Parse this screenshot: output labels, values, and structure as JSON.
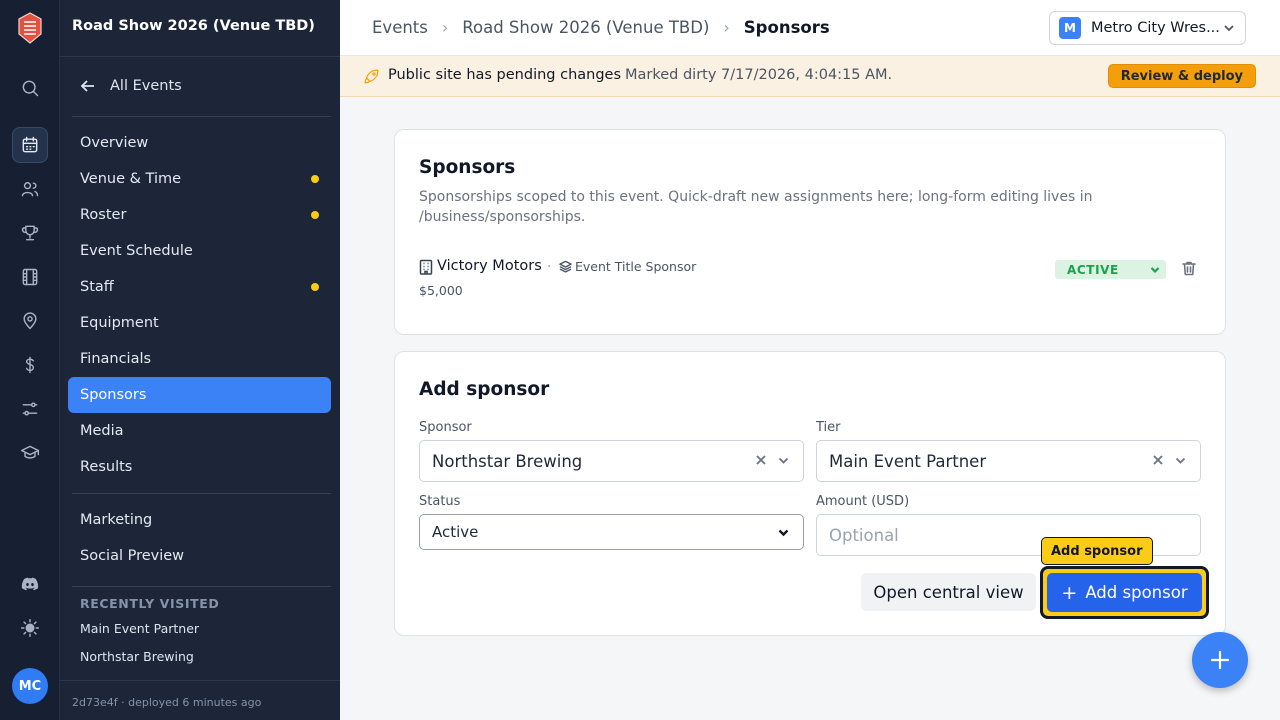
{
  "sidebar": {
    "event_title": "Road Show 2026 (Venue TBD)",
    "back_label": "All Events",
    "nav": [
      {
        "label": "Overview",
        "dirty": false,
        "active": false
      },
      {
        "label": "Venue & Time",
        "dirty": true,
        "active": false
      },
      {
        "label": "Roster",
        "dirty": true,
        "active": false
      },
      {
        "label": "Event Schedule",
        "dirty": false,
        "active": false
      },
      {
        "label": "Staff",
        "dirty": true,
        "active": false
      },
      {
        "label": "Equipment",
        "dirty": false,
        "active": false
      },
      {
        "label": "Financials",
        "dirty": false,
        "active": false
      },
      {
        "label": "Sponsors",
        "dirty": false,
        "active": true
      },
      {
        "label": "Media",
        "dirty": false,
        "active": false
      },
      {
        "label": "Results",
        "dirty": false,
        "active": false
      }
    ],
    "nav_secondary": [
      {
        "label": "Marketing"
      },
      {
        "label": "Social Preview"
      }
    ],
    "recent_heading": "RECENTLY VISITED",
    "recent": [
      "Main Event Partner",
      "Northstar Brewing"
    ],
    "footer": "2d73e4f · deployed 6 minutes ago"
  },
  "rail": {
    "icons": [
      "search-icon",
      "calendar-icon",
      "users-icon",
      "trophy-icon",
      "film-icon",
      "map-pin-icon",
      "dollar-icon",
      "sliders-icon",
      "graduation-cap-icon",
      "discord-icon",
      "sun-icon"
    ],
    "active": "calendar-icon",
    "avatar_initials": "MC"
  },
  "header": {
    "breadcrumbs": [
      "Events",
      "Road Show 2026 (Venue TBD)",
      "Sponsors"
    ],
    "org_badge": "M",
    "org_name": "Metro City Wres..."
  },
  "banner": {
    "message": "Public site has pending changes",
    "dirty_text": "Marked dirty 7/17/2026, 4:04:15 AM.",
    "button_label": "Review & deploy",
    "accent": "#f59e0b"
  },
  "sponsors_card": {
    "title": "Sponsors",
    "description": "Sponsorships scoped to this event. Quick-draft new assignments here; long-form editing lives in /business/sponsorships.",
    "rows": [
      {
        "name": "Victory Motors",
        "separator": "·",
        "tier": "Event Title Sponsor",
        "amount": "$5,000",
        "status": "ACTIVE"
      }
    ]
  },
  "add_card": {
    "title": "Add sponsor",
    "sponsor_label": "Sponsor",
    "sponsor_value": "Northstar Brewing",
    "tier_label": "Tier",
    "tier_value": "Main Event Partner",
    "status_label": "Status",
    "status_value": "Active",
    "amount_label": "Amount (USD)",
    "amount_placeholder": "Optional",
    "central_button": "Open central view",
    "add_button": "Add sponsor",
    "add_button_plus": "+",
    "tooltip": "Add sponsor"
  }
}
